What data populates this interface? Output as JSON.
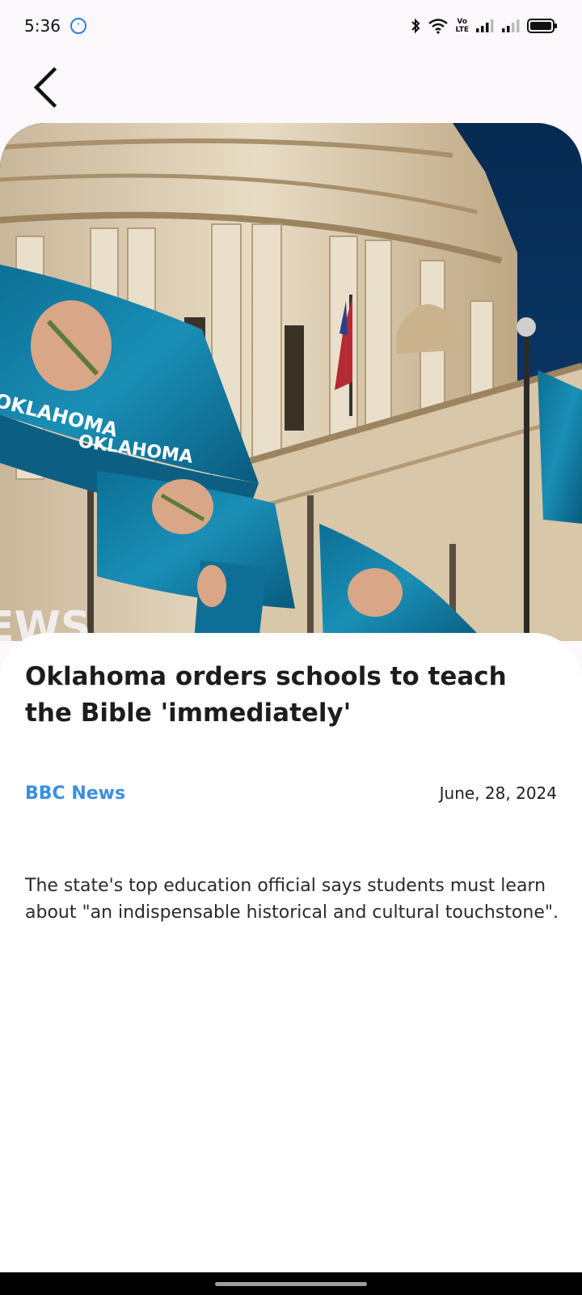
{
  "status_bar": {
    "time": "5:36",
    "badge_icon": "chat-bubble-icon",
    "icons": [
      "bluetooth-icon",
      "wifi-icon",
      "volte-icon",
      "signal-icon",
      "signal-icon",
      "battery-icon"
    ],
    "volte_top": "Vo",
    "volte_bottom": "LTE"
  },
  "header": {
    "back_icon": "chevron-left-icon"
  },
  "hero": {
    "image_icon": "oklahoma-capitol-flags-image",
    "flag_text_1": "OKLAHOMA",
    "flag_text_2": "OKLAHOMA",
    "watermark": "EWS"
  },
  "article": {
    "title": "Oklahoma orders schools to teach the Bible 'immediately'",
    "source": "BBC News",
    "date": "June, 28, 2024",
    "summary": "The state's top education official says students must learn about \"an indispensable historical and cultural touchstone\"."
  },
  "colors": {
    "accent": "#3b8fdc",
    "text": "#1d1d1f",
    "background": "#fcf8fc"
  }
}
